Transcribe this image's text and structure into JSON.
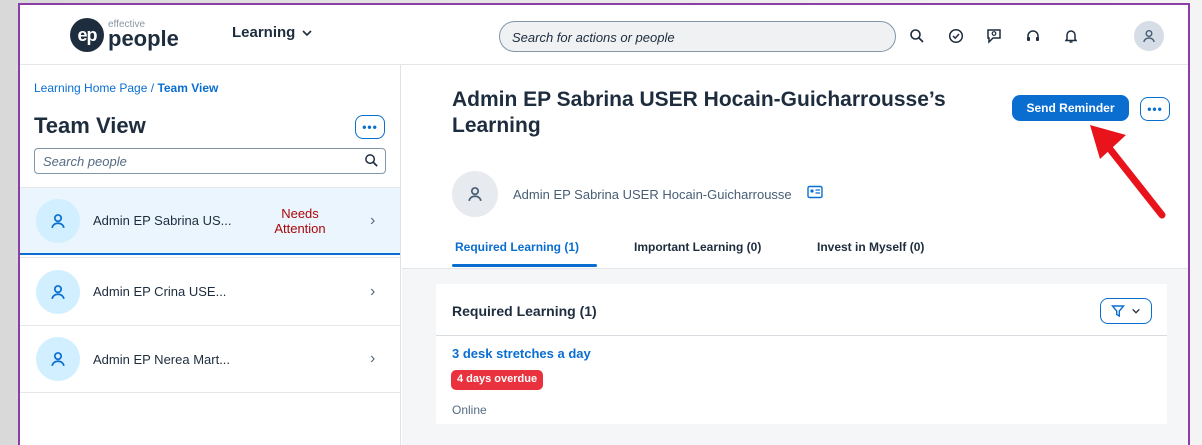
{
  "header": {
    "logo_small": "effective",
    "logo_big": "people",
    "logo_mark": "ep",
    "app_name": "Learning",
    "search_placeholder": "Search for actions or people",
    "icons": [
      "search-icon",
      "check-circle-icon",
      "chat-icon",
      "headset-icon",
      "bell-icon",
      "user-icon"
    ]
  },
  "sidebar": {
    "breadcrumb_home": "Learning Home Page",
    "breadcrumb_sep": " / ",
    "breadcrumb_current": "Team View",
    "title": "Team View",
    "more_label": "•••",
    "search_placeholder": "Search people",
    "people": [
      {
        "name": "Admin EP Sabrina US...",
        "status": "Needs Attention"
      },
      {
        "name": "Admin EP Crina USE...",
        "status": ""
      },
      {
        "name": "Admin EP Nerea Mart...",
        "status": ""
      }
    ]
  },
  "main": {
    "title": "Admin EP Sabrina USER Hocain-Guicharrousse’s Learning",
    "send_reminder": "Send Reminder",
    "more_label": "•••",
    "user_full_name": "Admin EP Sabrina USER Hocain-Guicharrousse",
    "tabs": [
      {
        "label": "Required Learning (1)",
        "active": true
      },
      {
        "label": "Important Learning (0)",
        "active": false
      },
      {
        "label": "Invest in Myself (0)",
        "active": false
      }
    ],
    "card": {
      "title": "Required Learning (1)",
      "course": "3 desk stretches a day",
      "badge": "4 days overdue",
      "delivery": "Online"
    }
  },
  "colors": {
    "accent": "#0a6ed1",
    "overdue": "#e9323e",
    "attention": "#aa0808",
    "annotation_arrow": "#e8131b"
  }
}
